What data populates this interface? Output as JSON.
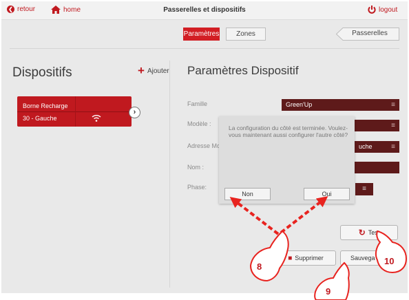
{
  "topbar": {
    "back_label": "retour",
    "home_label": "home",
    "title": "Passerelles et dispositifs",
    "logout_label": "logout"
  },
  "tabs": [
    {
      "label": "Paramètres",
      "active": true
    },
    {
      "label": "Zones",
      "active": false
    }
  ],
  "passerelles_tab": "Passerelles",
  "left_panel": {
    "title": "Dispositifs",
    "add_label": "Ajouter",
    "device": {
      "name": "Borne Recharge",
      "sub": "30 - Gauche"
    }
  },
  "right_panel": {
    "title": "Paramètres Dispositif",
    "fields": [
      {
        "label": "Famille",
        "value": "Green'Up"
      },
      {
        "label": "Modèle :",
        "value": ""
      },
      {
        "label": "Adresse Mo",
        "value": "uche"
      },
      {
        "label": "Nom :",
        "value": ""
      },
      {
        "label": "Phase:",
        "value": ""
      }
    ]
  },
  "dialog": {
    "message": "La configuration du côté est terminée. Voulez-vous maintenant aussi configurer l'autre côté?",
    "no_label": "Non",
    "yes_label": "Oui"
  },
  "actions": {
    "test_label": "Test",
    "delete_label": "Supprimer",
    "save_label": "Sauvega"
  },
  "callouts": [
    "8",
    "9",
    "10"
  ],
  "colors": {
    "brand_red": "#c0191f",
    "field_bg": "#5e1a1a",
    "annotation": "#e8231f"
  }
}
